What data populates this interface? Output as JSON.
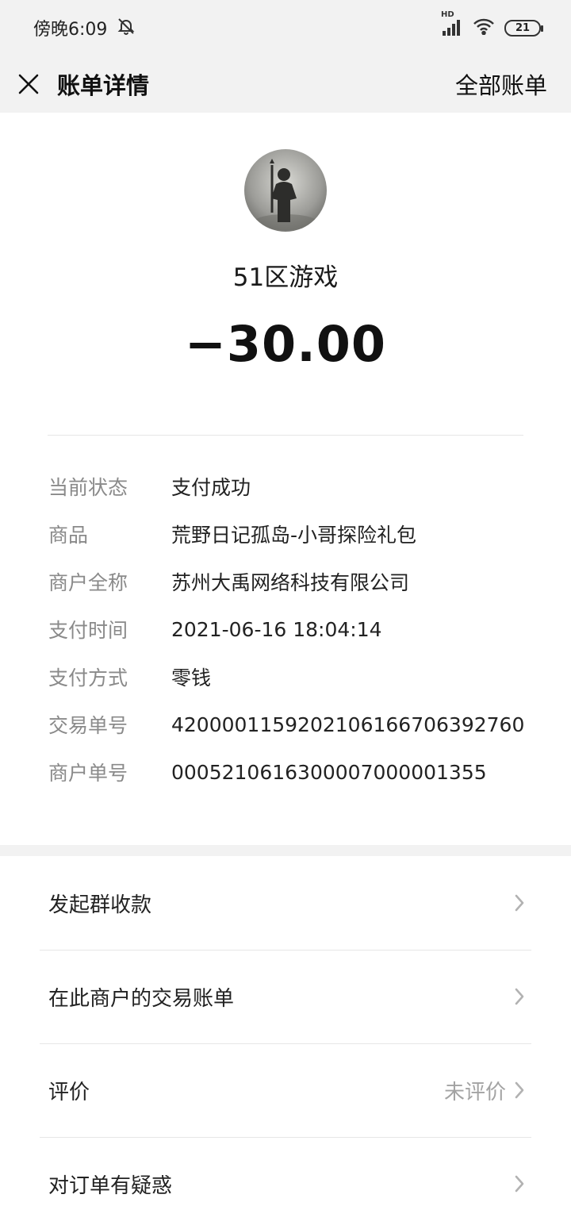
{
  "status_bar": {
    "time": "傍晚6:09",
    "network": "HD",
    "battery": "21"
  },
  "nav": {
    "title": "账单详情",
    "right_link": "全部账单"
  },
  "transaction": {
    "merchant_name": "51区游戏",
    "amount": "−30.00"
  },
  "details": [
    {
      "label": "当前状态",
      "value": "支付成功"
    },
    {
      "label": "商品",
      "value": "荒野日记孤岛-小哥探险礼包"
    },
    {
      "label": "商户全称",
      "value": "苏州大禹网络科技有限公司"
    },
    {
      "label": "支付时间",
      "value": "2021-06-16 18:04:14"
    },
    {
      "label": "支付方式",
      "value": "零钱"
    },
    {
      "label": "交易单号",
      "value": "4200001159202106166706392760"
    },
    {
      "label": "商户单号",
      "value": "0005210616300007000001355"
    }
  ],
  "actions": [
    {
      "label": "发起群收款",
      "extra": ""
    },
    {
      "label": "在此商户的交易账单",
      "extra": ""
    },
    {
      "label": "评价",
      "extra": "未评价"
    },
    {
      "label": "对订单有疑惑",
      "extra": ""
    }
  ],
  "icons": {
    "mute": "bell-off-icon",
    "signal": "signal-icon",
    "wifi": "wifi-icon",
    "close": "close-icon",
    "chevron": "chevron-right-icon"
  },
  "colors": {
    "bar_background": "#f2f2f2",
    "label_gray": "#8a8a8a",
    "text_dark": "#111111"
  }
}
